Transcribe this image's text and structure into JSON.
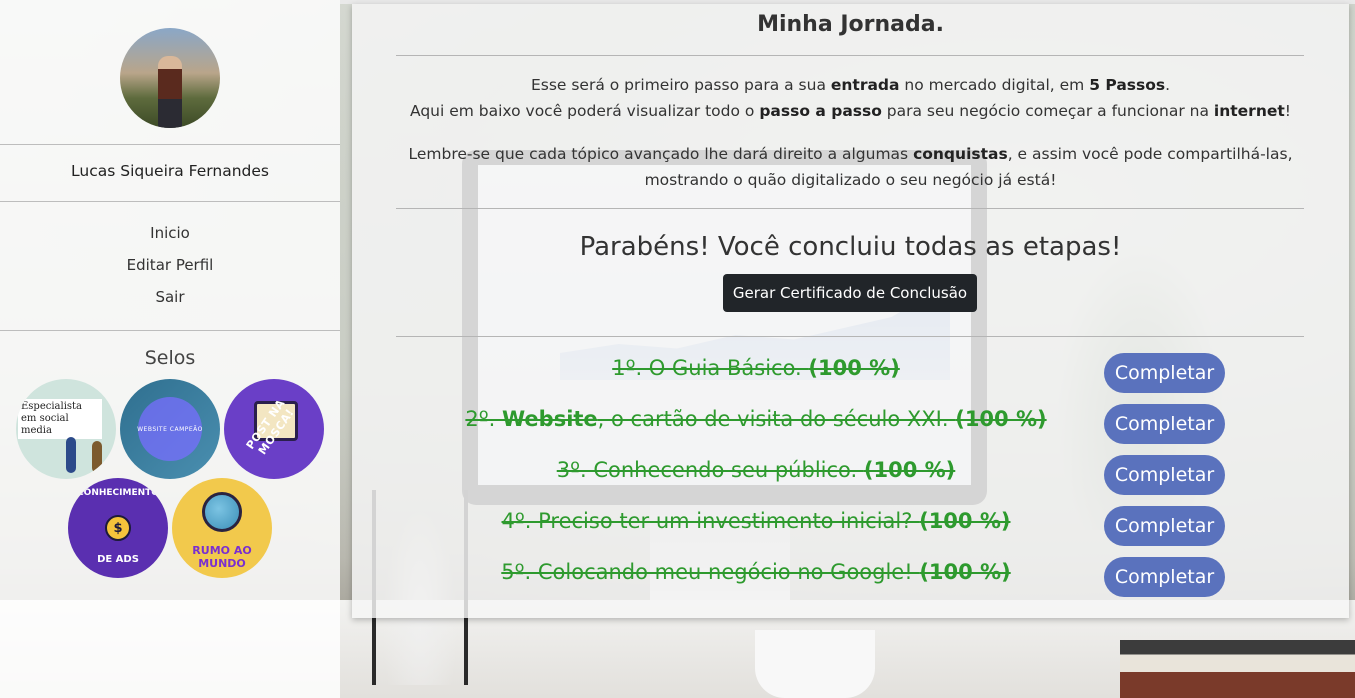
{
  "profile": {
    "name": "Lucas Siqueira Fernandes"
  },
  "nav": {
    "items": [
      "Inicio",
      "Editar Perfil",
      "Sair"
    ]
  },
  "selos": {
    "title": "Selos",
    "badges": [
      {
        "name": "especialista-social-media",
        "text": "Especialista em social media"
      },
      {
        "name": "website-campeao",
        "text": "WEBSITE CAMPEÃO"
      },
      {
        "name": "post-na-mosca",
        "text": "POST NA MOSCA!"
      },
      {
        "name": "conhecimento-de-ads",
        "text_top": "CONHECIMENTO",
        "text_bottom": "DE ADS",
        "coin": "$"
      },
      {
        "name": "rumo-ao-mundo",
        "text": "RUMO AO MUNDO"
      }
    ]
  },
  "main": {
    "title": "Minha Jornada.",
    "intro_line1_a": "Esse será o primeiro passo para a sua ",
    "intro_line1_b": "entrada",
    "intro_line1_c": " no mercado digital, em ",
    "intro_line1_d": "5 Passos",
    "intro_line1_e": ".",
    "intro_line2_a": "Aqui em baixo você poderá visualizar todo o ",
    "intro_line2_b": "passo a passo",
    "intro_line2_c": " para seu negócio começar a funcionar na ",
    "intro_line2_d": "internet",
    "intro_line2_e": "!",
    "intro_line3_a": "Lembre-se que cada tópico avançado lhe dará direito a algumas ",
    "intro_line3_b": "conquistas",
    "intro_line3_c": ", e assim você pode compartilhá-las,",
    "intro_line4": "mostrando o quão digitalizado o seu negócio já está!",
    "congrats": "Parabéns! Você concluiu todas as etapas!",
    "certificate_button": "Gerar Certificado de Conclusão"
  },
  "steps": [
    {
      "prefix": "1º. O Guia Básico. ",
      "bold_prefix": "",
      "percent": "(100 %)",
      "button": "Completar",
      "progress": 100
    },
    {
      "prefix": "2º. ",
      "bold_prefix": "Website",
      "rest": ", o cartão de visita do século XXI. ",
      "percent": "(100 %)",
      "button": "Completar",
      "progress": 100
    },
    {
      "prefix": "3º. Conhecendo seu público. ",
      "bold_prefix": "",
      "percent": "(100 %)",
      "button": "Completar",
      "progress": 100
    },
    {
      "prefix": "4º. Preciso ter um investimento inicial? ",
      "bold_prefix": "",
      "percent": "(100 %)",
      "button": "Completar",
      "progress": 100
    },
    {
      "prefix": "5º. Colocando meu negócio no Google! ",
      "bold_prefix": "",
      "percent": "(100 %)",
      "button": "Completar",
      "progress": 100
    }
  ],
  "colors": {
    "step_done": "#2e9a2e",
    "complete_button": "#5a72bd",
    "certificate_button": "#212529"
  }
}
